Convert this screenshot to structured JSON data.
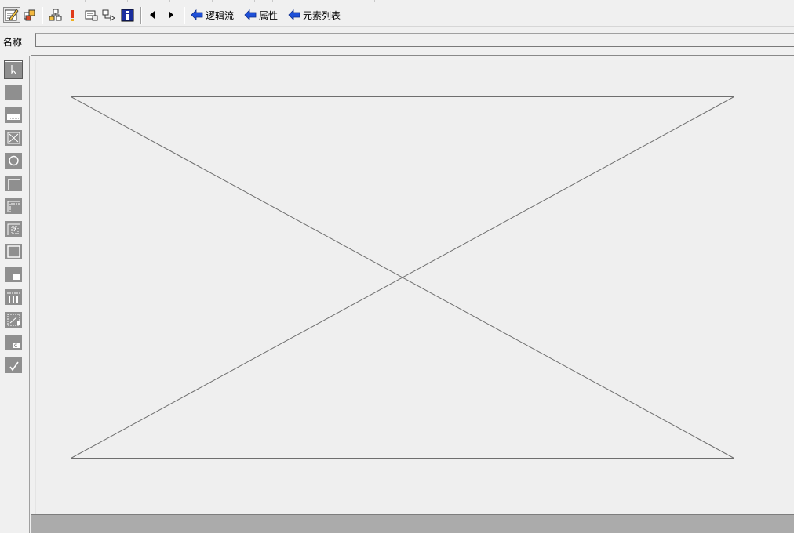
{
  "toolbar": {
    "nav_links": [
      {
        "label": "逻辑流",
        "icon": "arrow-left-icon"
      },
      {
        "label": "属性",
        "icon": "arrow-left-icon"
      },
      {
        "label": "元素列表",
        "icon": "arrow-left-icon"
      }
    ],
    "icon_buttons": [
      "edit-form-icon",
      "layout-icon",
      "hierarchy-icon",
      "exclamation-icon",
      "properties-icon",
      "flow-icon",
      "info-icon",
      "back-triangle-icon",
      "forward-triangle-icon"
    ]
  },
  "name_row": {
    "label": "名称",
    "value": ""
  },
  "palette": {
    "tools": [
      "pointer-tool-icon",
      "box-tool-icon",
      "input-tool-icon",
      "image-tool-icon",
      "radio-tool-icon",
      "frame-tool-icon",
      "group-tool-icon",
      "checklist-tool-icon",
      "container-tool-icon",
      "panel-tool-icon",
      "table-tool-icon",
      "grid-tool-icon",
      "caption-tool-icon",
      "checkbox-tool-icon"
    ],
    "active_index": 0
  },
  "colors": {
    "background": "#f0f0f0",
    "palette_icon": "#8f8f8f",
    "nav_arrow": "#1e50d8",
    "bottom_strip": "#ababab"
  }
}
